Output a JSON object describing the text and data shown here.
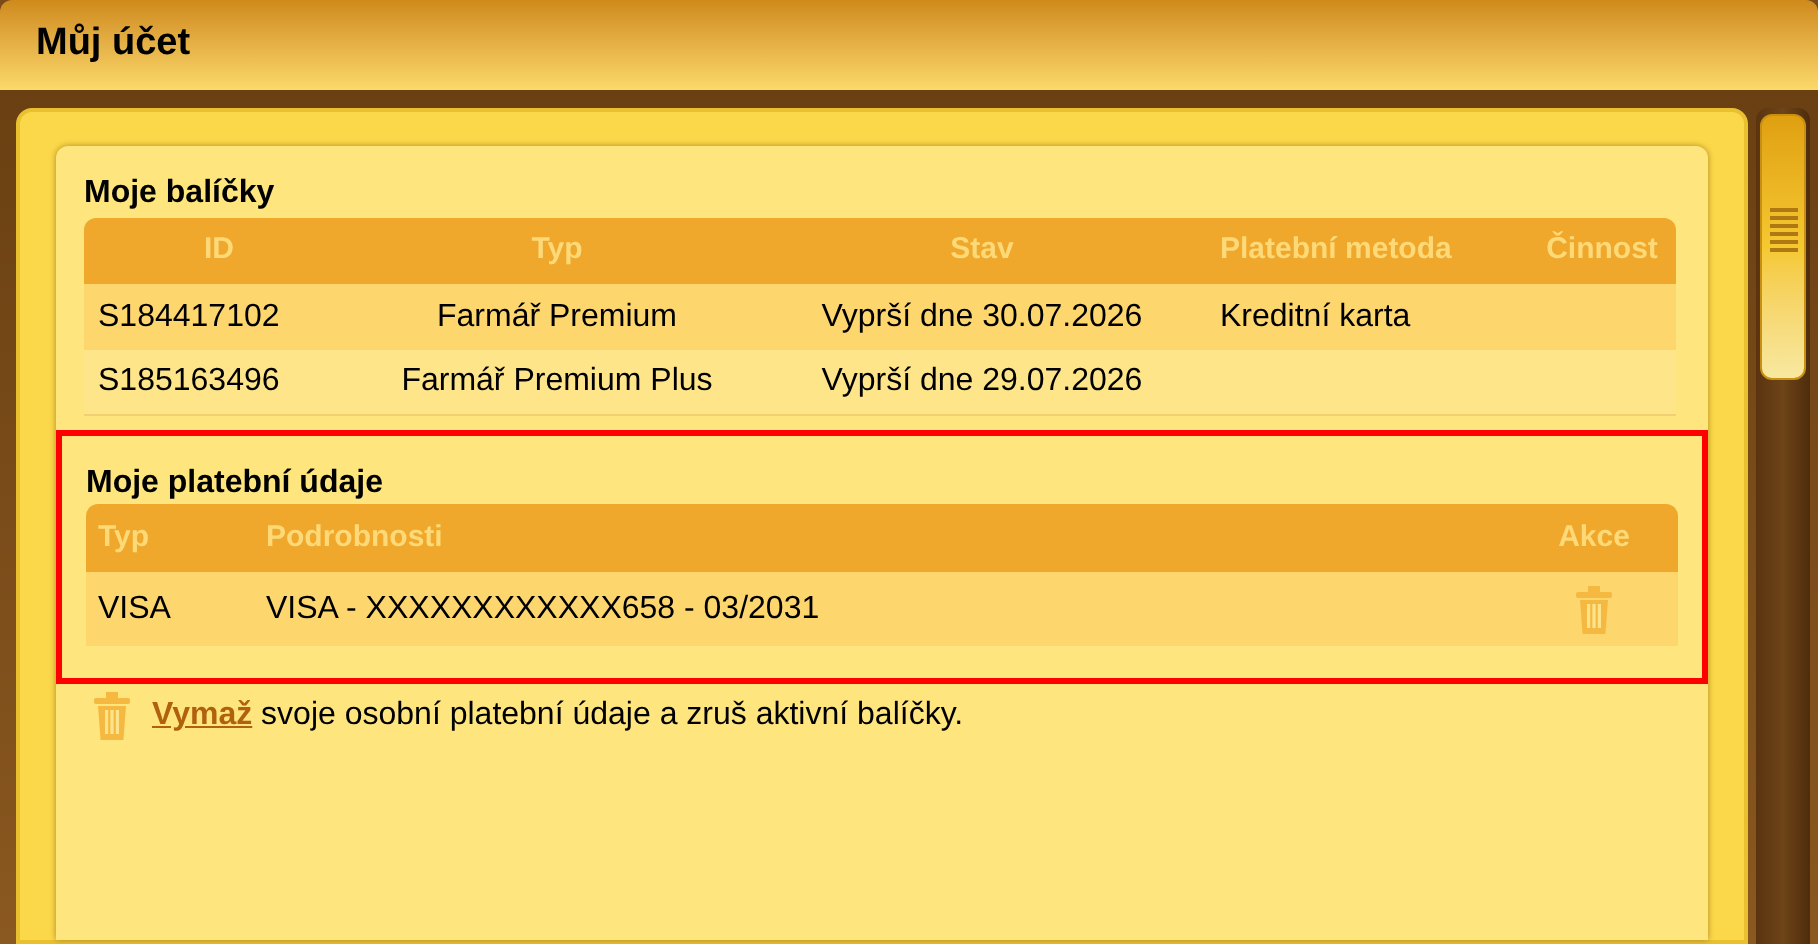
{
  "window": {
    "title": "Můj účet"
  },
  "packages": {
    "title": "Moje balíčky",
    "columns": [
      "ID",
      "Typ",
      "Stav",
      "Platební metoda",
      "Činnost"
    ],
    "rows": [
      [
        "S184417102",
        "Farmář Premium",
        "Vyprší dne 30.07.2026",
        "Kreditní karta",
        ""
      ],
      [
        "S185163496",
        "Farmář Premium Plus",
        "Vyprší dne 29.07.2026",
        "",
        ""
      ]
    ]
  },
  "payment": {
    "title": "Moje platební údaje",
    "highlighted": true,
    "columns": [
      "Typ",
      "Podrobnosti",
      "Akce"
    ],
    "rows": [
      {
        "type": "VISA",
        "details": "VISA - XXXXXXXXXXXX658 - 03/2031"
      }
    ]
  },
  "footer": {
    "link": "Vymaž",
    "text": " svoje osobní platební údaje a zruš aktivní balíčky."
  }
}
